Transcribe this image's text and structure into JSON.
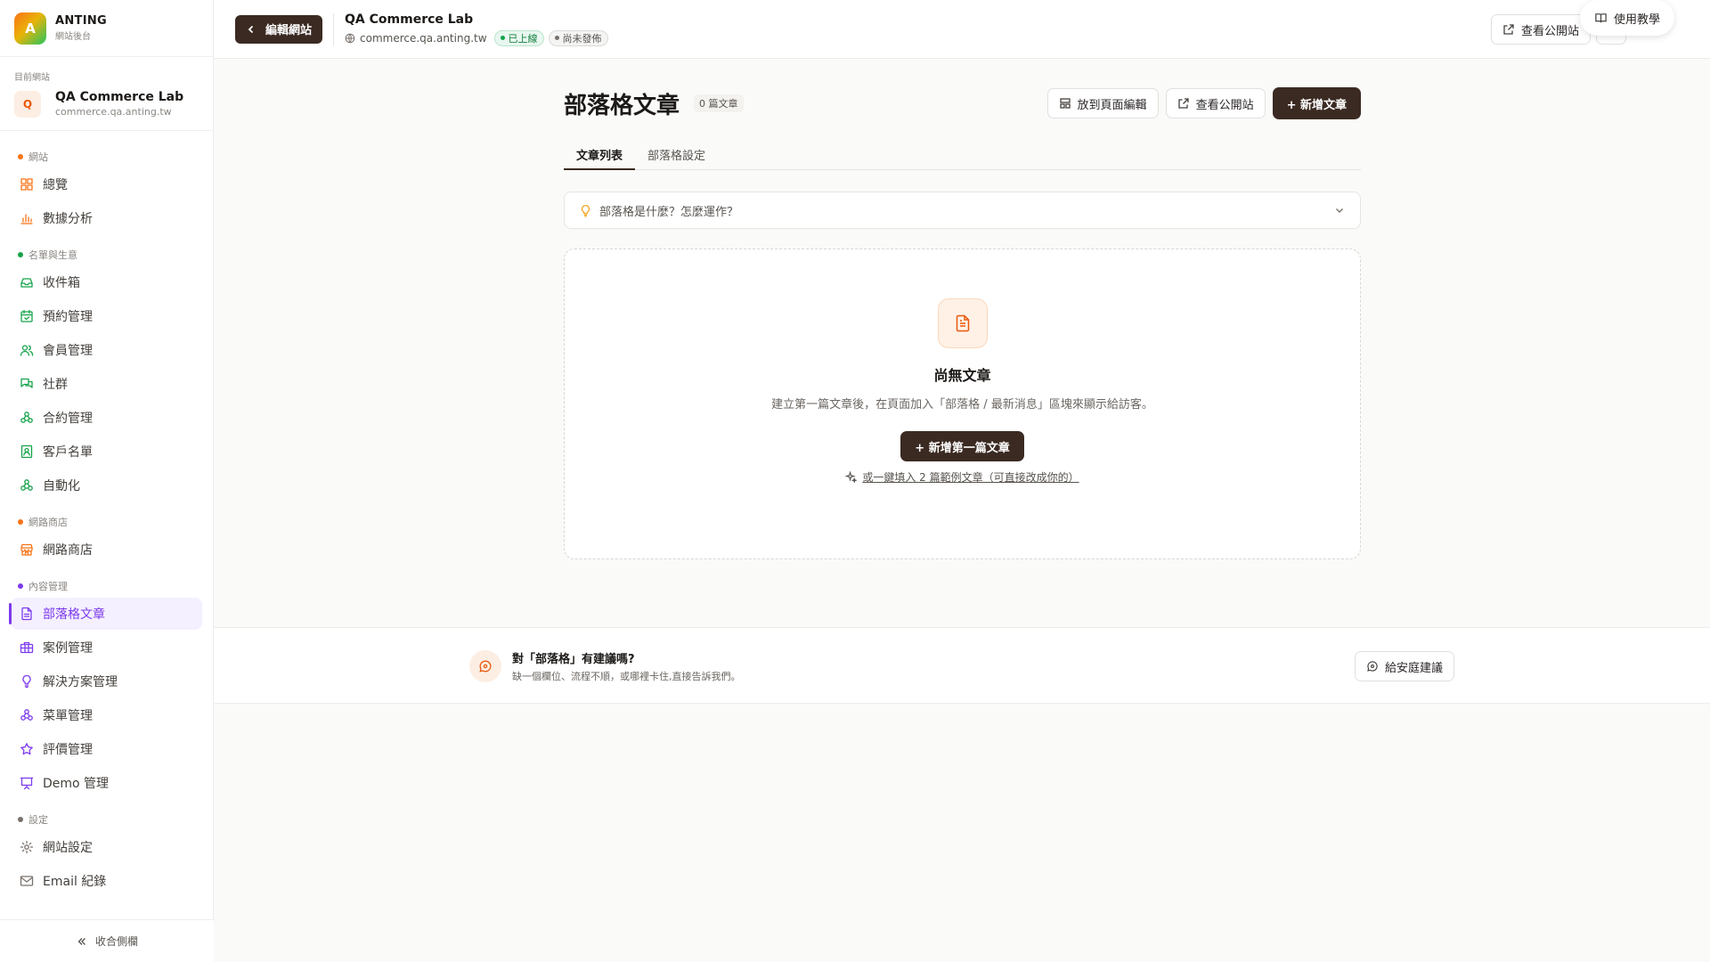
{
  "brand": {
    "logo_letter": "A",
    "name": "ANTING",
    "sub": "網站後台"
  },
  "current_site": {
    "label": "目前網站",
    "avatar": "Q",
    "name": "QA Commerce Lab",
    "url": "commerce.qa.anting.tw"
  },
  "sidebar": {
    "sections": [
      {
        "title": "網站",
        "color": "#f97316",
        "items": [
          {
            "label": "總覽",
            "icon": "grid-icon",
            "color": "#f97316"
          },
          {
            "label": "數據分析",
            "icon": "bar-chart-icon",
            "color": "#f97316"
          }
        ]
      },
      {
        "title": "名單與生意",
        "color": "#16a34a",
        "items": [
          {
            "label": "收件箱",
            "icon": "inbox-icon",
            "color": "#16a34a"
          },
          {
            "label": "預約管理",
            "icon": "calendar-icon",
            "color": "#16a34a"
          },
          {
            "label": "會員管理",
            "icon": "users-icon",
            "color": "#16a34a"
          },
          {
            "label": "社群",
            "icon": "chat-icon",
            "color": "#16a34a"
          },
          {
            "label": "合約管理",
            "icon": "nodes-icon",
            "color": "#16a34a"
          },
          {
            "label": "客戶名單",
            "icon": "contact-icon",
            "color": "#16a34a"
          },
          {
            "label": "自動化",
            "icon": "nodes-icon",
            "color": "#16a34a"
          }
        ]
      },
      {
        "title": "網路商店",
        "color": "#f97316",
        "items": [
          {
            "label": "網路商店",
            "icon": "store-icon",
            "color": "#f97316"
          }
        ]
      },
      {
        "title": "內容管理",
        "color": "#7c3aed",
        "items": [
          {
            "label": "部落格文章",
            "icon": "document-icon",
            "color": "#7c3aed",
            "active": true
          },
          {
            "label": "案例管理",
            "icon": "briefcase-icon",
            "color": "#7c3aed"
          },
          {
            "label": "解決方案管理",
            "icon": "bulb-icon",
            "color": "#7c3aed"
          },
          {
            "label": "菜單管理",
            "icon": "nodes-icon",
            "color": "#7c3aed"
          },
          {
            "label": "評價管理",
            "icon": "star-icon",
            "color": "#7c3aed"
          },
          {
            "label": "Demo 管理",
            "icon": "presentation-icon",
            "color": "#7c3aed"
          }
        ]
      },
      {
        "title": "設定",
        "color": "#78716c",
        "items": [
          {
            "label": "網站設定",
            "icon": "gear-icon",
            "color": "#78716c"
          },
          {
            "label": "Email 紀錄",
            "icon": "mail-icon",
            "color": "#78716c"
          }
        ]
      }
    ],
    "collapse_label": "收合側欄"
  },
  "topbar": {
    "back_label": "編輯網站",
    "site_title": "QA Commerce Lab",
    "site_url": "commerce.qa.anting.tw",
    "badge_live": "已上線",
    "badge_draft": "尚未發佈",
    "view_site": "查看公開站",
    "help": "使用教學"
  },
  "main": {
    "title": "部落格文章",
    "count": "0 篇文章",
    "actions": {
      "place": "放到頁面編輯",
      "view": "查看公開站",
      "new": "+ 新增文章"
    },
    "tabs": [
      {
        "label": "文章列表",
        "active": true
      },
      {
        "label": "部落格設定",
        "active": false
      }
    ],
    "faq": "部落格是什麼？怎麼運作？",
    "empty": {
      "title": "尚無文章",
      "desc": "建立第一篇文章後，在頁面加入「部落格 / 最新消息」區塊來顯示給訪客。",
      "button": "+ 新增第一篇文章",
      "quickfill": "或一鍵填入 2 篇範例文章（可直接改成你的）"
    }
  },
  "feedback": {
    "title": "對「部落格」有建議嗎?",
    "sub": "缺一個欄位、流程不順，或哪裡卡住,直接告訴我們。",
    "button": "給安庭建議"
  },
  "colors": {
    "accent_dark": "#3b2a22",
    "content_purple": "#7c3aed",
    "orange": "#f97316",
    "green": "#16a34a"
  }
}
